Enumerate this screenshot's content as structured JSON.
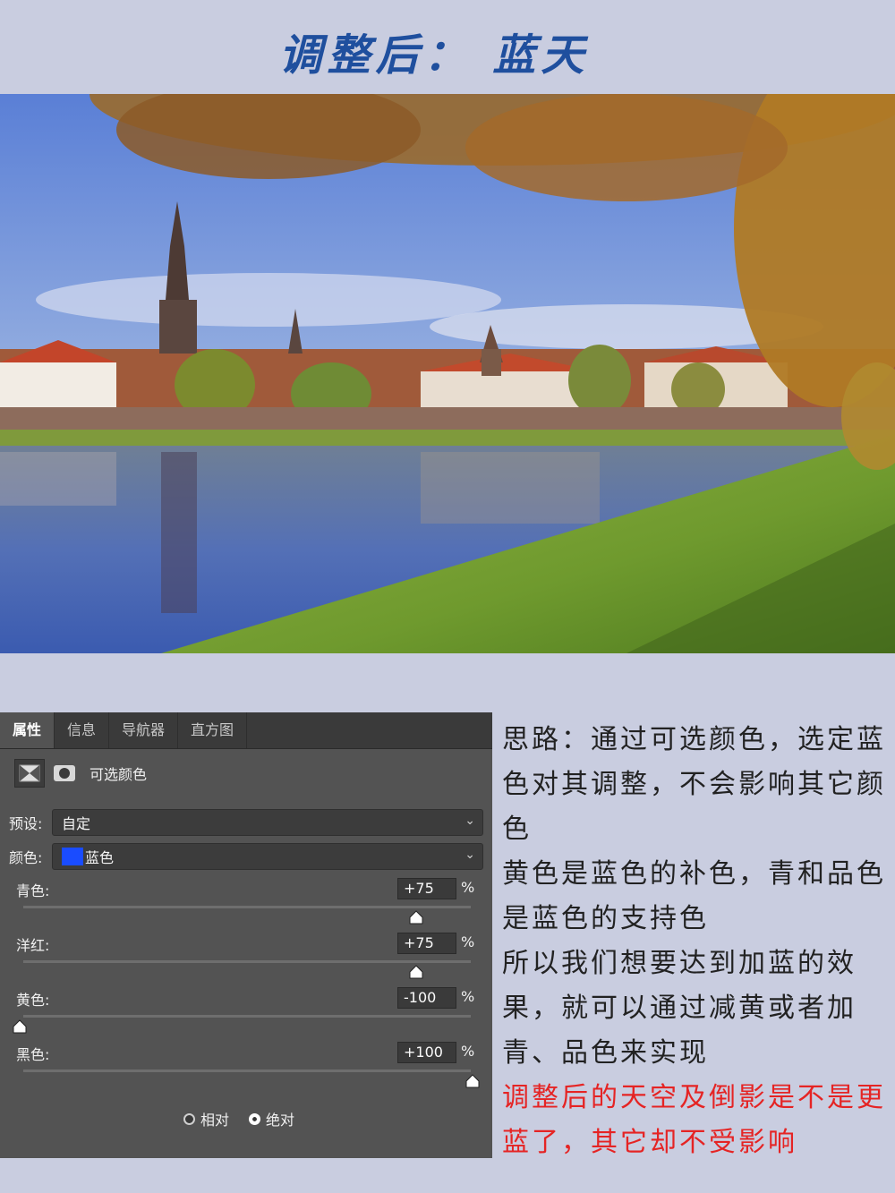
{
  "title": "调整后：  蓝天",
  "panel": {
    "tabs": [
      {
        "label": "属性",
        "active": true
      },
      {
        "label": "信息",
        "active": false
      },
      {
        "label": "导航器",
        "active": false
      },
      {
        "label": "直方图",
        "active": false
      }
    ],
    "adjustment_name": "可选颜色",
    "preset_label": "预设:",
    "preset_value": "自定",
    "color_label": "颜色:",
    "color_value": "蓝色",
    "color_swatch": "#1a4cff",
    "sliders": [
      {
        "label": "青色:",
        "value": "+75",
        "unit": "%"
      },
      {
        "label": "洋红:",
        "value": "+75",
        "unit": "%"
      },
      {
        "label": "黄色:",
        "value": "-100",
        "unit": "%"
      },
      {
        "label": "黑色:",
        "value": "+100",
        "unit": "%"
      }
    ],
    "method_relative": "相对",
    "method_absolute": "绝对",
    "method_selected": "绝对"
  },
  "notes": {
    "p1": "思路：通过可选颜色，选定蓝色对其调整，不会影响其它颜色",
    "p2": "黄色是蓝色的补色，青和品色是蓝色的支持色",
    "p3": "所以我们想要达到加蓝的效果，就可以通过减黄或者加青、品色来实现",
    "p4": "调整后的天空及倒影是不是更蓝了，其它却不受影响"
  }
}
